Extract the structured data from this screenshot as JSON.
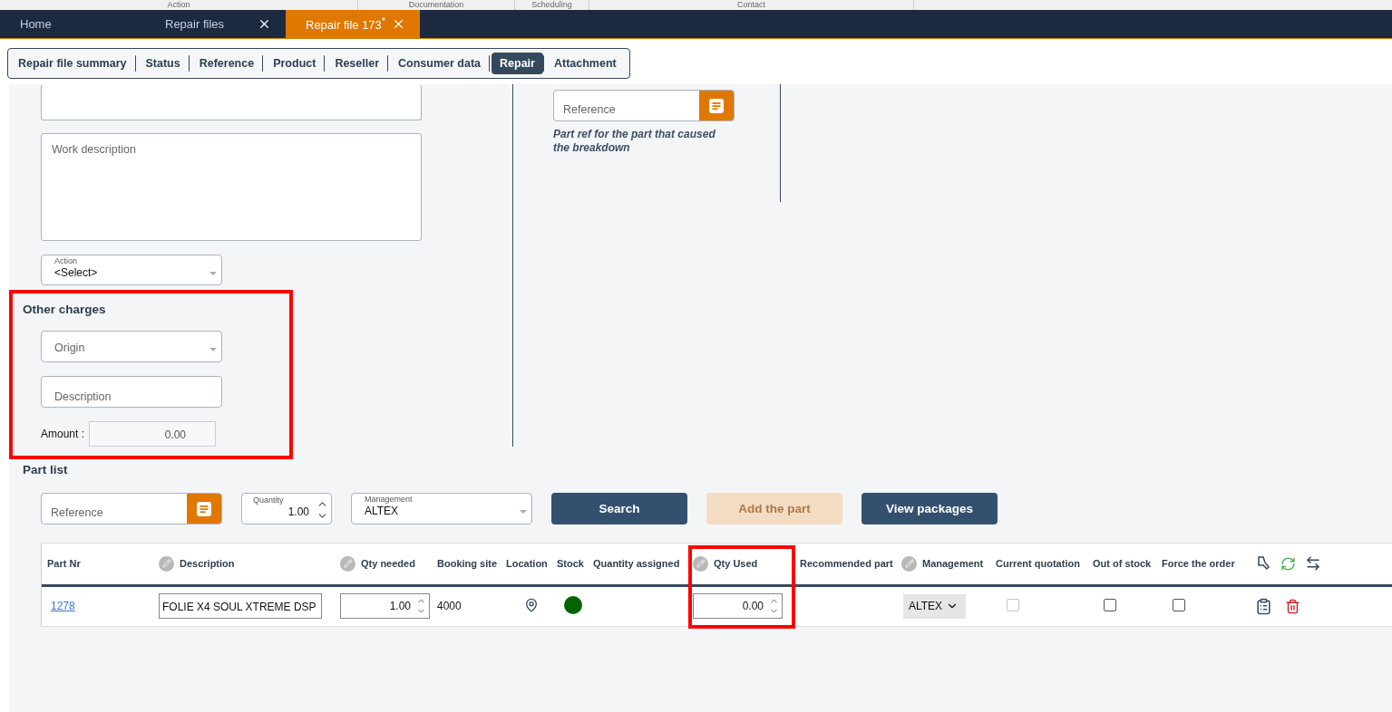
{
  "top_menu": [
    {
      "label": "Action"
    },
    {
      "label": "Documentation"
    },
    {
      "label": "Scheduling"
    },
    {
      "label": "Contact"
    }
  ],
  "nav_tabs": [
    {
      "label": "Home",
      "selected": false,
      "closable": false
    },
    {
      "label": "Repair files",
      "selected": false,
      "closable": true
    },
    {
      "label": "Repair file 173$^{*}$",
      "selected": true,
      "closable": true
    }
  ],
  "section_tabs": [
    {
      "label": "Repair file summary",
      "selected": false
    },
    {
      "label": "Status",
      "selected": false
    },
    {
      "label": "Reference",
      "selected": false
    },
    {
      "label": "Product",
      "selected": false
    },
    {
      "label": "Reseller",
      "selected": false
    },
    {
      "label": "Consumer data",
      "selected": false
    },
    {
      "label": "Repair",
      "selected": true
    },
    {
      "label": "Attachment",
      "selected": false
    }
  ],
  "work_description": {
    "placeholder": "Work description"
  },
  "action_select": {
    "label": "Action",
    "value": "<Select>"
  },
  "other_charges": {
    "title": "Other charges",
    "highlighted": true,
    "origin": {
      "placeholder": "Origin"
    },
    "description": {
      "placeholder": "Description"
    },
    "amount": {
      "label": "Amount :",
      "value": "0.00"
    }
  },
  "breakdown_reference": {
    "placeholder": "Reference",
    "hint": "Part ref for the part that caused the breakdown"
  },
  "part_list": {
    "title": "Part list",
    "reference": {
      "placeholder": "Reference"
    },
    "quantity": {
      "label": "Quantity",
      "value": "1.00"
    },
    "management": {
      "label": "Management",
      "value": "ALTEX"
    },
    "buttons": [
      {
        "label": "Search",
        "disabled": false
      },
      {
        "label": "Add the part",
        "disabled": true
      },
      {
        "label": "View packages",
        "disabled": false
      }
    ]
  },
  "table": {
    "columns": [
      {
        "label": "Part Nr",
        "editable": false,
        "highlighted": false
      },
      {
        "label": "Description",
        "editable": true,
        "highlighted": false
      },
      {
        "label": "Qty needed",
        "editable": true,
        "highlighted": false
      },
      {
        "label": "Booking site",
        "editable": false,
        "highlighted": false
      },
      {
        "label": "Location",
        "editable": false,
        "highlighted": false
      },
      {
        "label": "Stock",
        "editable": false,
        "highlighted": false
      },
      {
        "label": "Quantity assigned",
        "editable": false,
        "highlighted": false
      },
      {
        "label": "Qty Used",
        "editable": true,
        "highlighted": true
      },
      {
        "label": "Recommended part",
        "editable": false,
        "highlighted": false
      },
      {
        "label": "Management",
        "editable": true,
        "highlighted": false
      },
      {
        "label": "Current quotation",
        "editable": false,
        "highlighted": false
      },
      {
        "label": "Out of stock",
        "editable": false,
        "highlighted": false
      },
      {
        "label": "Force the order",
        "editable": false,
        "highlighted": false
      }
    ],
    "rows": [
      {
        "part_nr": "1278",
        "description": "FOLIE X4 SOUL XTREME DSP",
        "qty_needed": "1.00",
        "booking_site": "4000",
        "stock": {
          "color": "#006400"
        },
        "qty_used": "0.00",
        "management": "ALTEX",
        "current_quotation": {
          "checked": false,
          "disabled": true
        },
        "out_of_stock": {
          "checked": false,
          "disabled": false
        },
        "force_order": {
          "checked": false,
          "disabled": false
        }
      }
    ]
  }
}
